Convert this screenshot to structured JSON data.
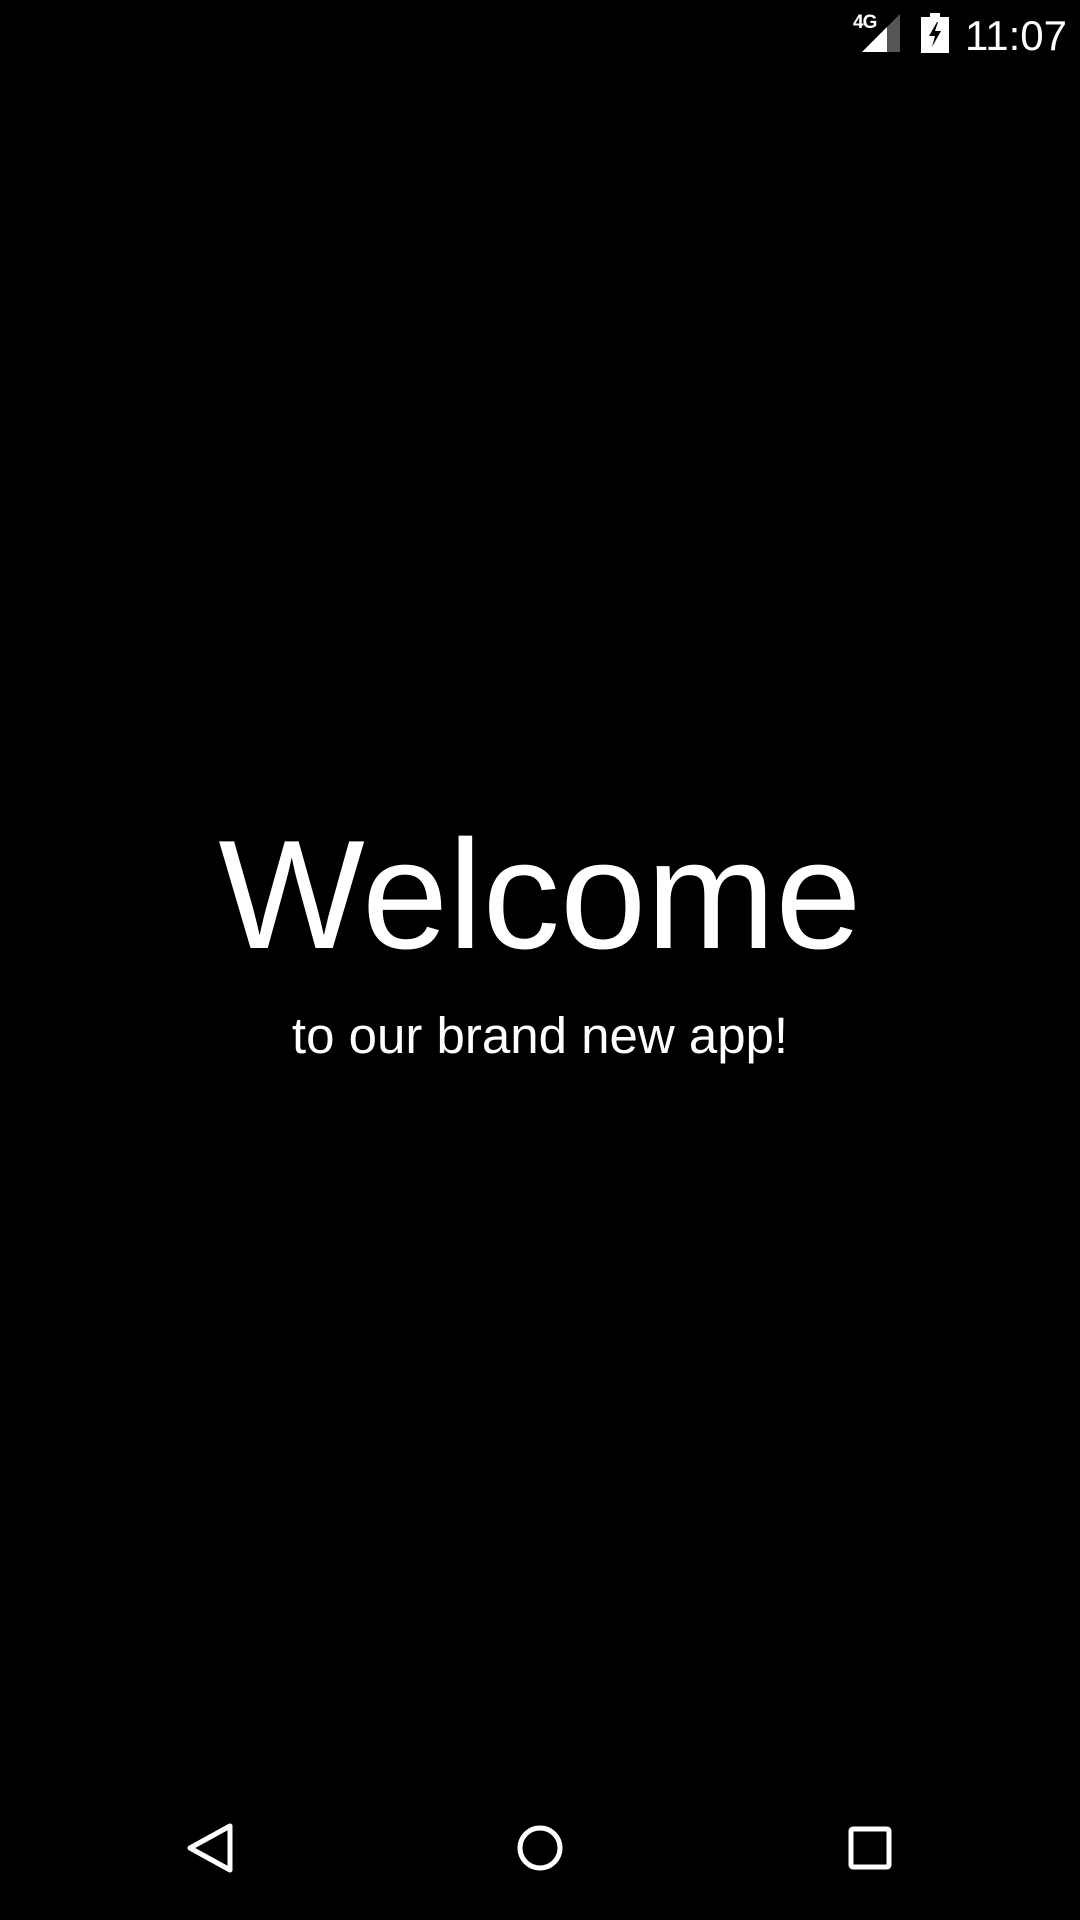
{
  "status_bar": {
    "network": "4G",
    "time": "11:07",
    "icons": [
      "signal-icon",
      "battery-charging-icon"
    ]
  },
  "main": {
    "title": "Welcome",
    "subtitle": "to our brand new app!"
  },
  "nav_bar": {
    "buttons": [
      "back",
      "home",
      "recents"
    ]
  },
  "colors": {
    "background": "#000000",
    "text": "#ffffff"
  }
}
